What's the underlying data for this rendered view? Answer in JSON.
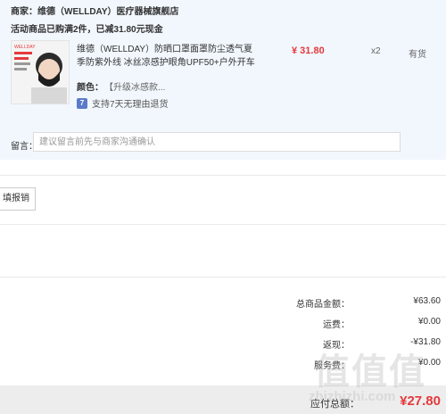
{
  "merchant": {
    "text": "商家：维德（WELLDAY）医疗器械旗舰店"
  },
  "promo": {
    "text": "活动商品已购满2件，已减31.80元现金"
  },
  "product": {
    "title": "维德（WELLDAY）防晒口罩面罩防尘透气夏季防紫外线 冰丝凉感护眼角UPF50+户外开车",
    "price": "¥ 31.80",
    "qty": "x2",
    "stock": "有货",
    "color_label": "颜色：",
    "color_value": "【升级冰感款...",
    "service_badge": "7",
    "service_text": "支持7天无理由退货",
    "thumb_brand": "WELLDAY"
  },
  "remark": {
    "label": "留言：",
    "placeholder": "建议留言前先与商家沟通确认"
  },
  "invoice": {
    "button": "填报销"
  },
  "summary": {
    "total_label": "总商品金额：",
    "total_value": "¥63.60",
    "freight_label": "运费：",
    "freight_value": "¥0.00",
    "discount_label": "返现：",
    "discount_value": "-¥31.80",
    "service_label": "服务费：",
    "service_value": "¥0.00"
  },
  "footer": {
    "pay_label": "应付总额：",
    "pay_value": "¥27.80"
  },
  "watermark": {
    "logo": "值值值",
    "site": "zhizhizhi.com"
  }
}
